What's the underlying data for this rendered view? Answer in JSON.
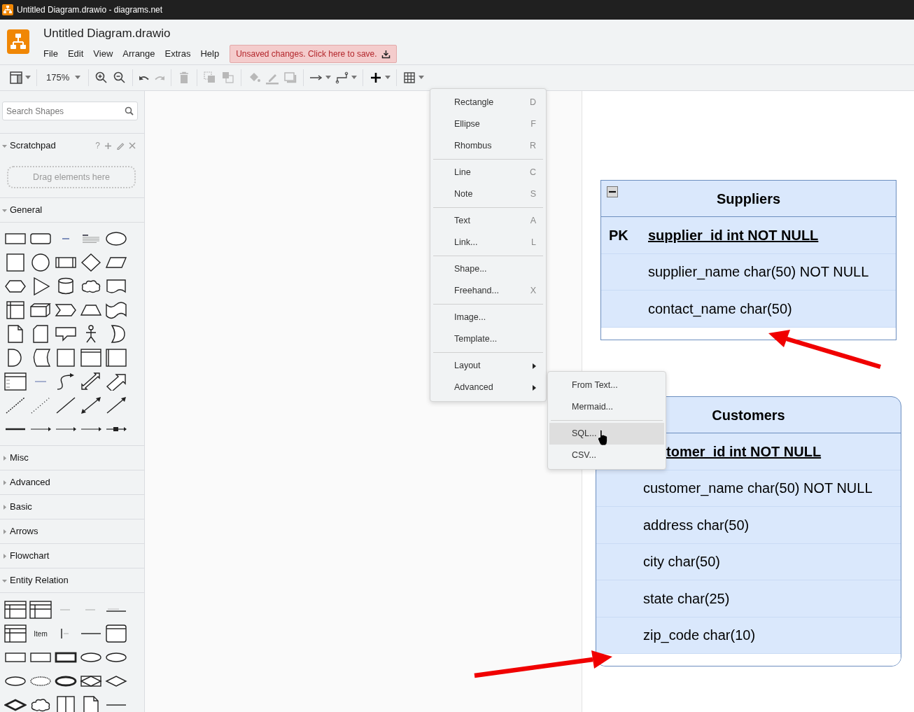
{
  "window": {
    "title": "Untitled Diagram.drawio - diagrams.net"
  },
  "header": {
    "file_name": "Untitled Diagram.drawio",
    "menus": [
      "File",
      "Edit",
      "View",
      "Arrange",
      "Extras",
      "Help"
    ],
    "unsaved_notice": "Unsaved changes. Click here to save."
  },
  "toolbar": [
    {
      "kind": "format-panel",
      "dropdown": true,
      "disabled": false
    },
    {
      "kind": "separator"
    },
    {
      "kind": "zoom",
      "label": "175%",
      "dropdown": true,
      "disabled": false
    },
    {
      "kind": "separator"
    },
    {
      "kind": "zoom-in",
      "dropdown": false,
      "disabled": false
    },
    {
      "kind": "zoom-out",
      "dropdown": false,
      "disabled": false
    },
    {
      "kind": "separator"
    },
    {
      "kind": "undo",
      "dropdown": false,
      "disabled": false
    },
    {
      "kind": "redo",
      "dropdown": false,
      "disabled": true
    },
    {
      "kind": "separator"
    },
    {
      "kind": "delete",
      "dropdown": false,
      "disabled": true
    },
    {
      "kind": "separator"
    },
    {
      "kind": "to-front",
      "dropdown": false,
      "disabled": true
    },
    {
      "kind": "to-back",
      "dropdown": false,
      "disabled": true
    },
    {
      "kind": "separator"
    },
    {
      "kind": "fill-color",
      "dropdown": false,
      "disabled": true
    },
    {
      "kind": "line-color",
      "dropdown": false,
      "disabled": true
    },
    {
      "kind": "shadow",
      "dropdown": false,
      "disabled": true
    },
    {
      "kind": "separator"
    },
    {
      "kind": "connection",
      "dropdown": true,
      "disabled": false
    },
    {
      "kind": "waypoints",
      "dropdown": true,
      "disabled": false
    },
    {
      "kind": "separator"
    },
    {
      "kind": "insert",
      "dropdown": true,
      "disabled": false
    },
    {
      "kind": "separator"
    },
    {
      "kind": "table",
      "dropdown": true,
      "disabled": false
    }
  ],
  "sidebar": {
    "search": {
      "placeholder": "Search Shapes"
    },
    "scratchpad": {
      "title": "Scratchpad",
      "expanded": true,
      "help": "?",
      "dropzone": "Drag elements here"
    },
    "sections": [
      {
        "title": "General",
        "expanded": true,
        "kind": "general"
      },
      {
        "title": "Misc",
        "expanded": false
      },
      {
        "title": "Advanced",
        "expanded": false
      },
      {
        "title": "Basic",
        "expanded": false
      },
      {
        "title": "Arrows",
        "expanded": false
      },
      {
        "title": "Flowchart",
        "expanded": false
      },
      {
        "title": "Entity Relation",
        "expanded": true,
        "kind": "entity",
        "item_label": "Item"
      }
    ]
  },
  "canvas": {
    "tables": [
      {
        "title": "Suppliers",
        "collapse_button": true,
        "rounded": false,
        "fields": [
          {
            "kind": "pk",
            "key": "PK",
            "name": "supplier_id int NOT NULL"
          },
          {
            "kind": "field",
            "name": "supplier_name char(50) NOT NULL"
          },
          {
            "kind": "field",
            "name": "contact_name char(50)"
          }
        ]
      },
      {
        "title": "Customers",
        "rounded": true,
        "fields": [
          {
            "kind": "pk-cut",
            "name": "tomer_id int NOT NULL"
          },
          {
            "kind": "field",
            "name": "customer_name char(50) NOT NULL"
          },
          {
            "kind": "field",
            "name": "address char(50)"
          },
          {
            "kind": "field",
            "name": "city char(50)"
          },
          {
            "kind": "field",
            "name": "state char(25)"
          },
          {
            "kind": "field",
            "name": "zip_code char(10)"
          }
        ]
      }
    ]
  },
  "insert_menu": {
    "groups": [
      [
        {
          "label": "Rectangle",
          "shortcut": "D",
          "has_submenu": false
        },
        {
          "label": "Ellipse",
          "shortcut": "F",
          "has_submenu": false
        },
        {
          "label": "Rhombus",
          "shortcut": "R",
          "has_submenu": false
        }
      ],
      [
        {
          "label": "Line",
          "shortcut": "C",
          "has_submenu": false
        },
        {
          "label": "Note",
          "shortcut": "S",
          "has_submenu": false
        }
      ],
      [
        {
          "label": "Text",
          "shortcut": "A",
          "has_submenu": false
        },
        {
          "label": "Link...",
          "shortcut": "L",
          "has_submenu": false
        }
      ],
      [
        {
          "label": "Shape...",
          "has_submenu": false
        },
        {
          "label": "Freehand...",
          "shortcut": "X",
          "has_submenu": false
        }
      ],
      [
        {
          "label": "Image...",
          "has_submenu": false
        },
        {
          "label": "Template...",
          "has_submenu": false
        }
      ],
      [
        {
          "label": "Layout",
          "has_submenu": true
        },
        {
          "label": "Advanced",
          "has_submenu": true
        }
      ]
    ]
  },
  "advanced_submenu": {
    "groups": [
      [
        {
          "label": "From Text...",
          "selected": false
        },
        {
          "label": "Mermaid...",
          "selected": false
        }
      ],
      [
        {
          "label": "SQL...",
          "selected": true
        },
        {
          "label": "CSV...",
          "selected": false
        }
      ]
    ]
  }
}
